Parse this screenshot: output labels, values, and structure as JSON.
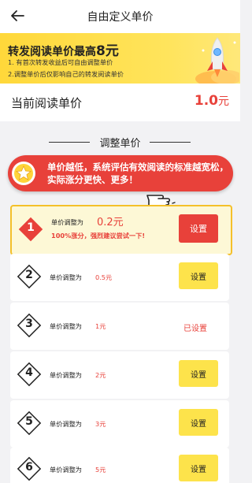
{
  "header": {
    "title": "自由定义单价"
  },
  "banner": {
    "headline_prefix": "转发阅读单价最高",
    "headline_highlight": "8元",
    "line1": "1. 有首次转发收益后可自由调整单价",
    "line2": "2.调整单价后仅影响自己的转发阅读单价"
  },
  "current": {
    "label": "当前阅读单价",
    "value": "1.0",
    "unit": "元"
  },
  "section": {
    "title": "调整单价"
  },
  "tip": {
    "text": "单价越低，系统评估有效阅读的标准越宽松，实际涨分更快、更多！"
  },
  "options": [
    {
      "num": "1",
      "desc": "单价调整为",
      "price": "0.2元",
      "note": "100%涨分，强烈建议尝试一下!",
      "action": "设置",
      "state": "active"
    },
    {
      "num": "2",
      "desc": "单价调整为",
      "price": "0.5元",
      "action": "设置",
      "state": "normal"
    },
    {
      "num": "3",
      "desc": "单价调整为",
      "price": "1元",
      "action": "已设置",
      "state": "set"
    },
    {
      "num": "4",
      "desc": "单价调整为",
      "price": "2元",
      "action": "设置",
      "state": "normal"
    },
    {
      "num": "5",
      "desc": "单价调整为",
      "price": "3元",
      "action": "设置",
      "state": "normal"
    },
    {
      "num": "6",
      "desc": "单价调整为",
      "price": "5元",
      "action": "设置",
      "state": "normal"
    }
  ],
  "colors": {
    "accent_red": "#e8413a",
    "accent_yellow": "#fde34b",
    "banner_yellow": "#ffd83a"
  }
}
